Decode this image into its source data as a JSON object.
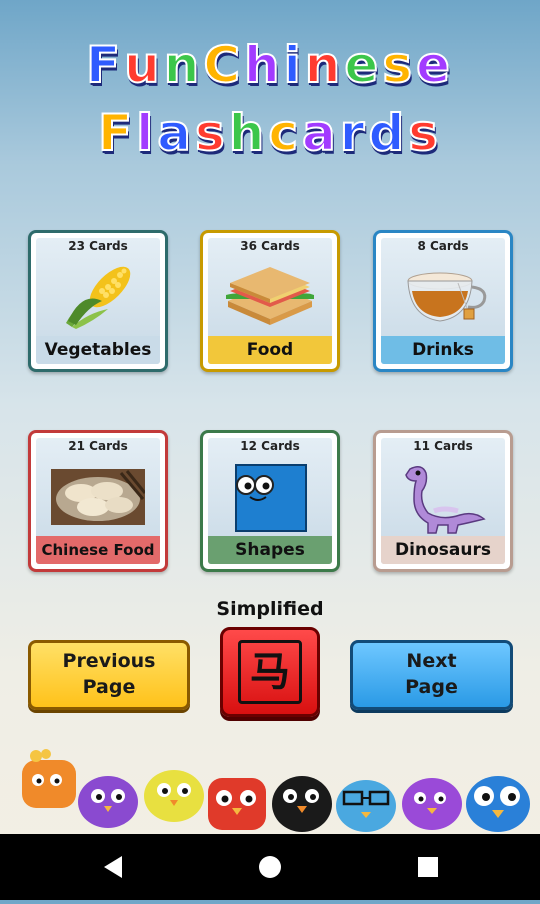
{
  "app": {
    "title_line1": "Fun Chinese",
    "title_line2": "Flashcards",
    "title_colors": [
      "#2f5bff",
      "#ff3b2f",
      "#3cc64a",
      "#ffb400",
      "#a23bff",
      "#2f5bff",
      "#ff3b2f",
      "#3cc64a",
      "#ffb400",
      "#a23bff",
      "#2f5bff"
    ]
  },
  "decks": [
    {
      "count": "23 Cards",
      "label": "Vegetables",
      "icon": "corn-icon",
      "border": "#2e6b6b",
      "label_bg": "#c9dbe8"
    },
    {
      "count": "36 Cards",
      "label": "Food",
      "icon": "sandwich-icon",
      "border": "#c79a00",
      "label_bg": "#f2c73a"
    },
    {
      "count": "8 Cards",
      "label": "Drinks",
      "icon": "tea-cup-icon",
      "border": "#2a86c4",
      "label_bg": "#6fbde6"
    },
    {
      "count": "21 Cards",
      "label": "Chinese Food",
      "icon": "dumplings-icon",
      "border": "#c23a3a",
      "label_bg": "#e36a6a"
    },
    {
      "count": "12 Cards",
      "label": "Shapes",
      "icon": "blue-square-icon",
      "border": "#3c7a4a",
      "label_bg": "#6aa070"
    },
    {
      "count": "11 Cards",
      "label": "Dinosaurs",
      "icon": "dinosaur-icon",
      "border": "#b89c90",
      "label_bg": "#e6d3cb"
    }
  ],
  "controls": {
    "mode_caption": "Simplified",
    "prev_label": "Previous Page",
    "next_label": "Next Page",
    "char_glyph": "马"
  },
  "mascots": [
    "orange-bird-icon",
    "purple-bird-icon",
    "yellow-bird-icon",
    "red-bird-icon",
    "black-bird-icon",
    "blue-bird-glasses-icon",
    "purple-bird-icon",
    "blue-bird-icon"
  ],
  "navbar": [
    "back-icon",
    "home-icon",
    "recents-icon"
  ]
}
